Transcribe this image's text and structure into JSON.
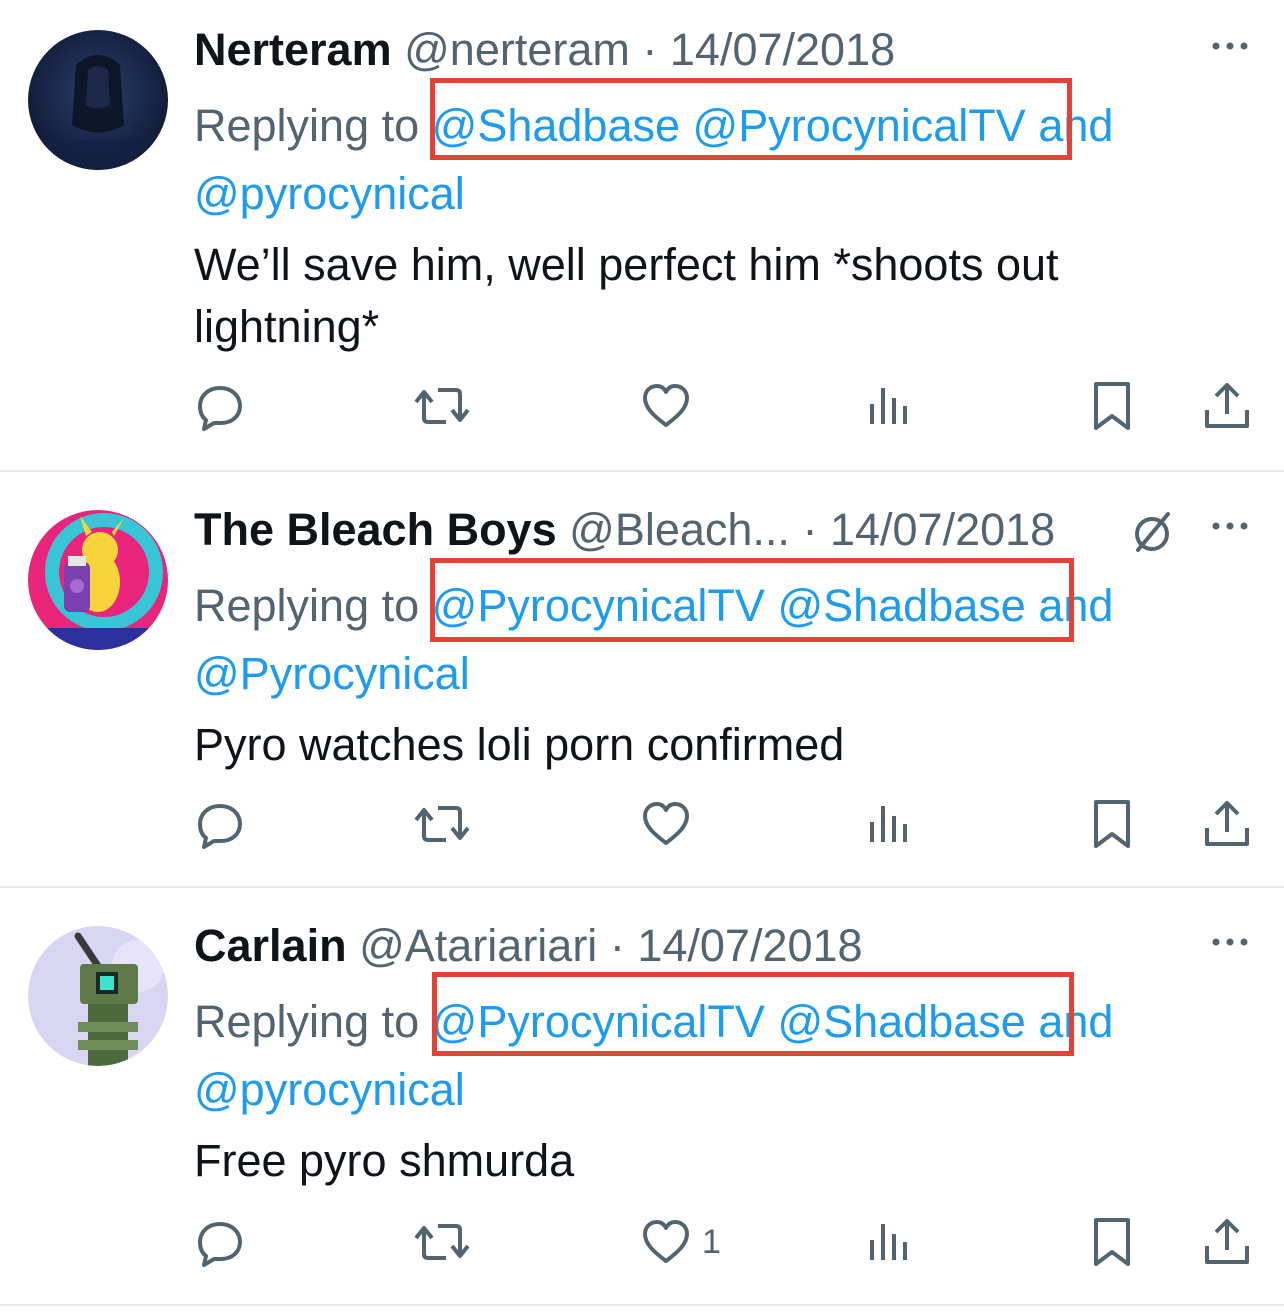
{
  "replies": [
    {
      "name": "Nerteram",
      "handle": "@nerteram",
      "dot": "·",
      "date": "14/07/2018",
      "replying_to": "Replying to",
      "mentions": [
        "@Shadbase",
        "@PyrocynicalTV"
      ],
      "and": "and",
      "last_mention": "@pyrocynical",
      "text": "We’ll save him, well perfect him *shoots out lightning*",
      "like_count": "",
      "verified": false
    },
    {
      "name": "The Bleach Boys",
      "handle": "@Bleach...",
      "dot": "·",
      "date": "14/07/2018",
      "replying_to": "Replying to",
      "mentions": [
        "@PyrocynicalTV",
        "@Shadbase"
      ],
      "and": "and",
      "last_mention": "@Pyrocynical",
      "text": "Pyro watches loli porn confirmed",
      "like_count": "",
      "verified": true
    },
    {
      "name": "Carlain",
      "handle": "@Atariariari",
      "dot": "·",
      "date": "14/07/2018",
      "replying_to": "Replying to",
      "mentions": [
        "@PyrocynicalTV",
        "@Shadbase"
      ],
      "and": "and",
      "last_mention": "@pyrocynical",
      "text": "Free pyro shmurda",
      "like_count": "1",
      "verified": false
    }
  ],
  "icons": {
    "reply": "reply-icon",
    "retweet": "retweet-icon",
    "like": "heart-icon",
    "views": "views-icon",
    "bookmark": "bookmark-icon",
    "share": "share-icon",
    "more": "more-icon",
    "verified": "verified-icon"
  },
  "colors": {
    "link": "#1d9bf0",
    "secondary": "#536471",
    "highlight": "#e34236",
    "divider": "#e6e9ec"
  }
}
